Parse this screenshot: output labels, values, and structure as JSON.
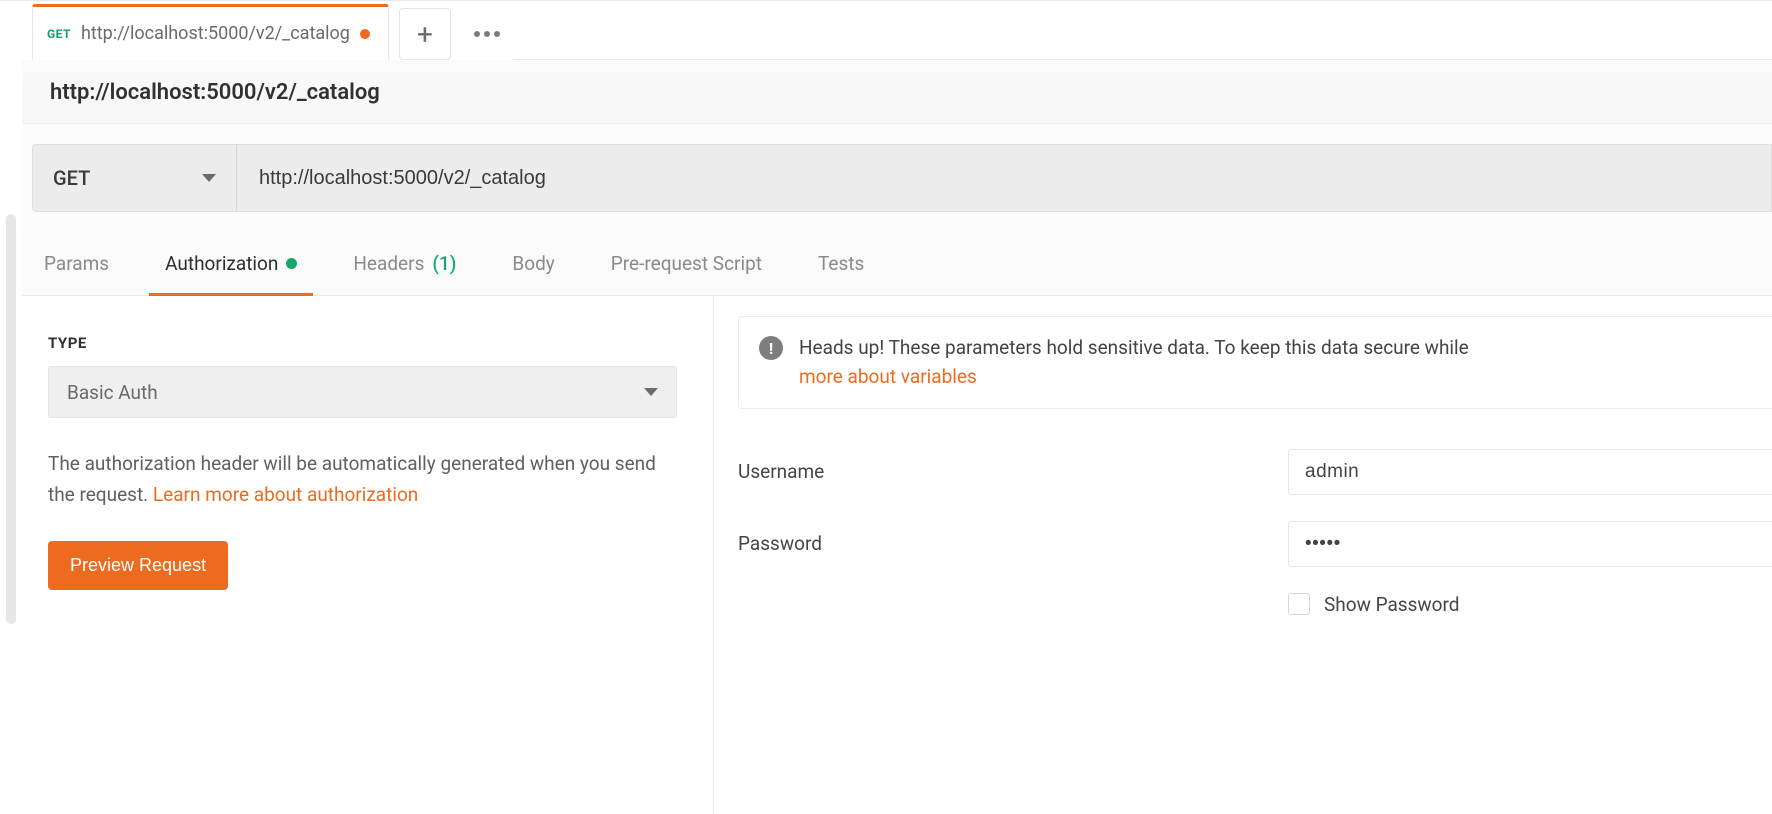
{
  "tab": {
    "method": "GET",
    "title": "http://localhost:5000/v2/_catalog",
    "dirty": true
  },
  "request": {
    "name": "http://localhost:5000/v2/_catalog",
    "method": "GET",
    "url": "http://localhost:5000/v2/_catalog"
  },
  "subtabs": {
    "params": "Params",
    "authorization": "Authorization",
    "headers": "Headers",
    "headers_count": "(1)",
    "body": "Body",
    "prerequest": "Pre-request Script",
    "tests": "Tests"
  },
  "auth": {
    "type_label": "TYPE",
    "type_value": "Basic Auth",
    "help_text_1": "The authorization header will be automatically generated when you send the request. ",
    "help_link": "Learn more about authorization",
    "preview_button": "Preview Request",
    "alert_text": "Heads up! These parameters hold sensitive data. To keep this data secure while",
    "alert_link": "more about variables",
    "username_label": "Username",
    "username_value": "admin",
    "password_label": "Password",
    "password_value": "•••••",
    "show_password_label": "Show Password"
  }
}
